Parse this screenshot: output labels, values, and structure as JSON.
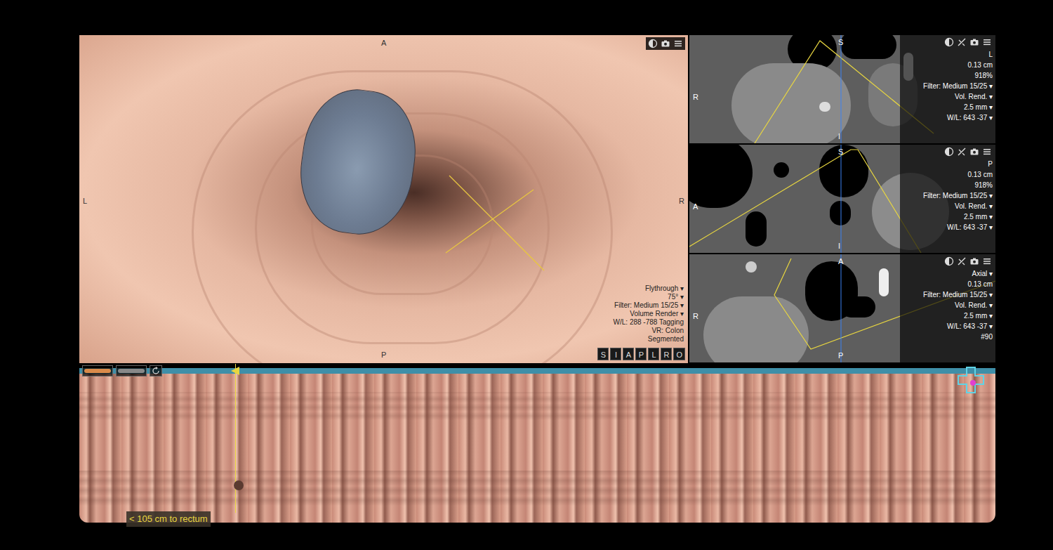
{
  "viewer3d": {
    "orientation": {
      "top": "A",
      "left": "L",
      "right": "R",
      "bottom": "P"
    },
    "settings": [
      "Flythrough ▾",
      "75° ▾",
      "Filter: Medium 15/25 ▾",
      "Volume Render ▾",
      "W/L: 288 -788 Tagging",
      "VR: Colon",
      "Segmented"
    ],
    "view_buttons": [
      "S",
      "I",
      "A",
      "P",
      "L",
      "R",
      "O"
    ]
  },
  "slices": [
    {
      "orientation": {
        "top": "S",
        "left": "R",
        "bottom": "I"
      },
      "settings": [
        "L",
        "0.13 cm",
        "918%",
        "Filter: Medium 15/25 ▾",
        "Vol. Rend. ▾",
        "2.5 mm ▾",
        "W/L: 643 -37 ▾"
      ]
    },
    {
      "orientation": {
        "top": "S",
        "left": "A",
        "bottom": "I"
      },
      "settings": [
        "P",
        "0.13 cm",
        "918%",
        "Filter: Medium 15/25 ▾",
        "Vol. Rend. ▾",
        "2.5 mm ▾",
        "W/L: 643 -37 ▾"
      ]
    },
    {
      "orientation": {
        "top": "A",
        "left": "R",
        "bottom": "P"
      },
      "settings": [
        "Axial ▾",
        "0.13 cm",
        "Filter: Medium 15/25 ▾",
        "Vol. Rend. ▾",
        "2.5 mm ▾",
        "W/L: 643 -37 ▾",
        "#90"
      ]
    }
  ],
  "colon_strip": {
    "distance": "< 105 cm to rectum"
  }
}
